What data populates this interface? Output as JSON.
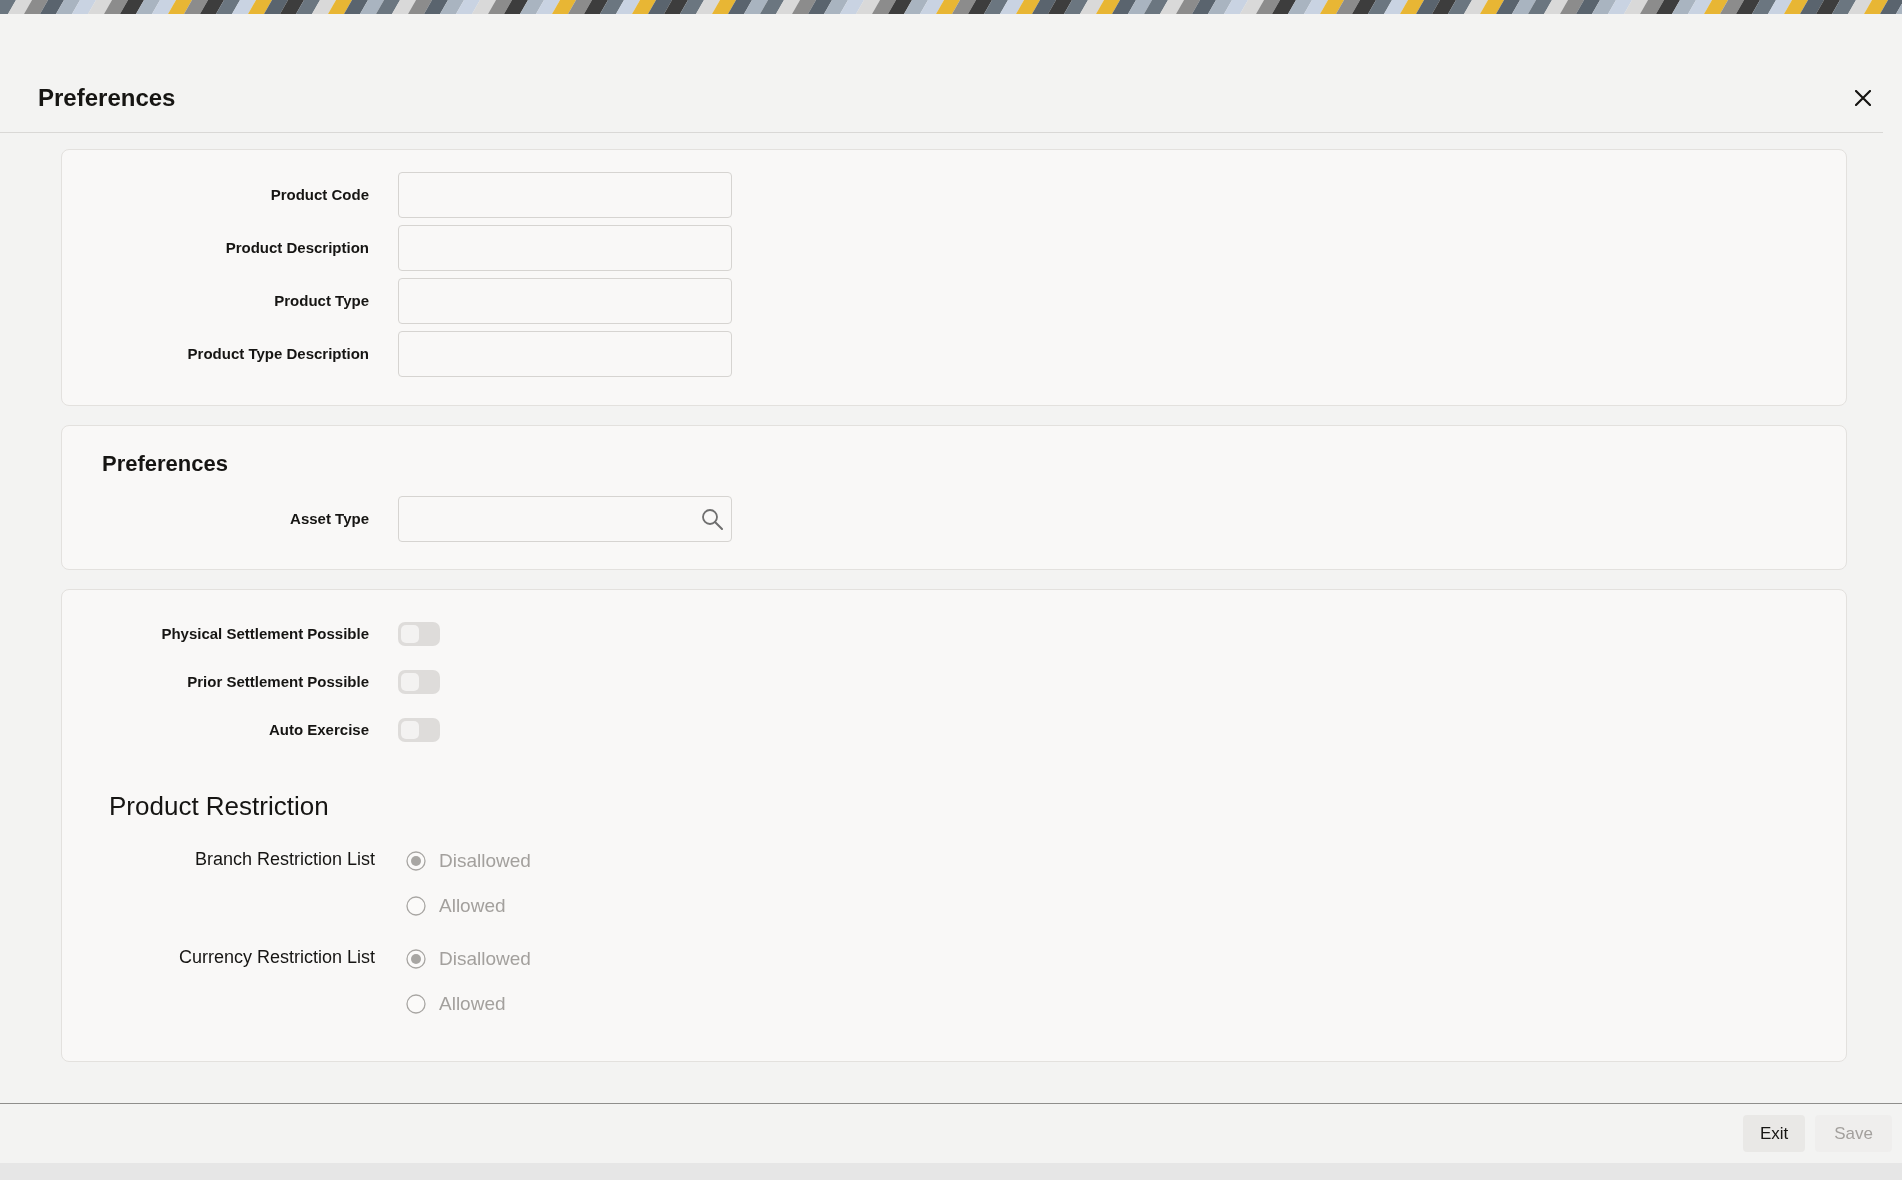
{
  "dialog": {
    "title": "Preferences"
  },
  "product_fields": [
    {
      "label": "Product Code"
    },
    {
      "label": "Product Description"
    },
    {
      "label": "Product Type"
    },
    {
      "label": "Product Type Description"
    }
  ],
  "preferences_section": {
    "heading": "Preferences",
    "fields": [
      {
        "label": "Asset Type",
        "kind": "lookup"
      }
    ]
  },
  "toggles": [
    {
      "label": "Physical Settlement Possible",
      "on": false
    },
    {
      "label": "Prior Settlement Possible",
      "on": false
    },
    {
      "label": "Auto Exercise",
      "on": false
    }
  ],
  "restriction_section": {
    "heading": "Product Restriction",
    "groups": [
      {
        "label": "Branch Restriction List",
        "disabled": true,
        "options": [
          {
            "label": "Disallowed",
            "selected": true
          },
          {
            "label": "Allowed",
            "selected": false
          }
        ]
      },
      {
        "label": "Currency Restriction List",
        "disabled": true,
        "options": [
          {
            "label": "Disallowed",
            "selected": true
          },
          {
            "label": "Allowed",
            "selected": false
          }
        ]
      }
    ]
  },
  "buttons": [
    {
      "label": "Exit",
      "disabled": false
    },
    {
      "label": "Save",
      "disabled": true
    }
  ]
}
